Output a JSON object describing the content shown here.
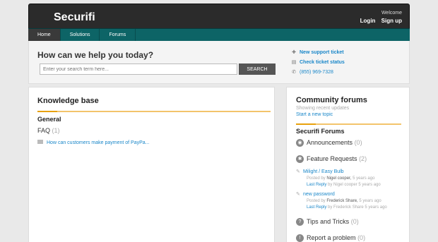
{
  "header": {
    "brand": "Securifi",
    "welcome": "Welcome",
    "login": "Login",
    "signup": "Sign up"
  },
  "nav": {
    "tabs": [
      {
        "label": "Home",
        "active": true
      },
      {
        "label": "Solutions",
        "active": false
      },
      {
        "label": "Forums",
        "active": false
      }
    ]
  },
  "help": {
    "question": "How can we help you today?",
    "search_placeholder": "Enter your search term here...",
    "search_button": "SEARCH",
    "links": [
      {
        "icon": "plus-icon",
        "label": "New support ticket"
      },
      {
        "icon": "ticket-icon",
        "label": "Check ticket status"
      },
      {
        "icon": "phone-icon",
        "label": "(855) 969-7328"
      }
    ]
  },
  "knowledge_base": {
    "title": "Knowledge base",
    "category": "General",
    "folder": {
      "name": "FAQ",
      "count": "(1)"
    },
    "article": "How can customers make payment of PayPa..."
  },
  "community": {
    "title": "Community forums",
    "subtitle": "Showing recent updates",
    "start_topic": "Start a new topic",
    "forum_group": "Securifi Forums",
    "forums": [
      {
        "icon": "announcement-icon",
        "name": "Announcements",
        "count": "(0)"
      },
      {
        "icon": "lightbulb-icon",
        "name": "Feature Requests",
        "count": "(2)"
      },
      {
        "icon": "tips-icon",
        "name": "Tips and Tricks",
        "count": "(0)"
      },
      {
        "icon": "report-icon",
        "name": "Report a problem",
        "count": "(0)"
      }
    ],
    "topics": [
      {
        "title": "Milight / Easy Bulb",
        "posted_label": "Posted by",
        "posted_by": "Nigel cooper,",
        "posted_when": "5 years ago",
        "last_label": "Last Reply",
        "last_by_text": "by",
        "last_by": "Nigel cooper",
        "last_when": "5 years ago"
      },
      {
        "title": "new password",
        "posted_label": "Posted by",
        "posted_by": "Frederick Share,",
        "posted_when": "5 years ago",
        "last_label": "Last Reply",
        "last_by_text": "by",
        "last_by": "Frederick Share",
        "last_when": "5 years ago"
      }
    ]
  }
}
